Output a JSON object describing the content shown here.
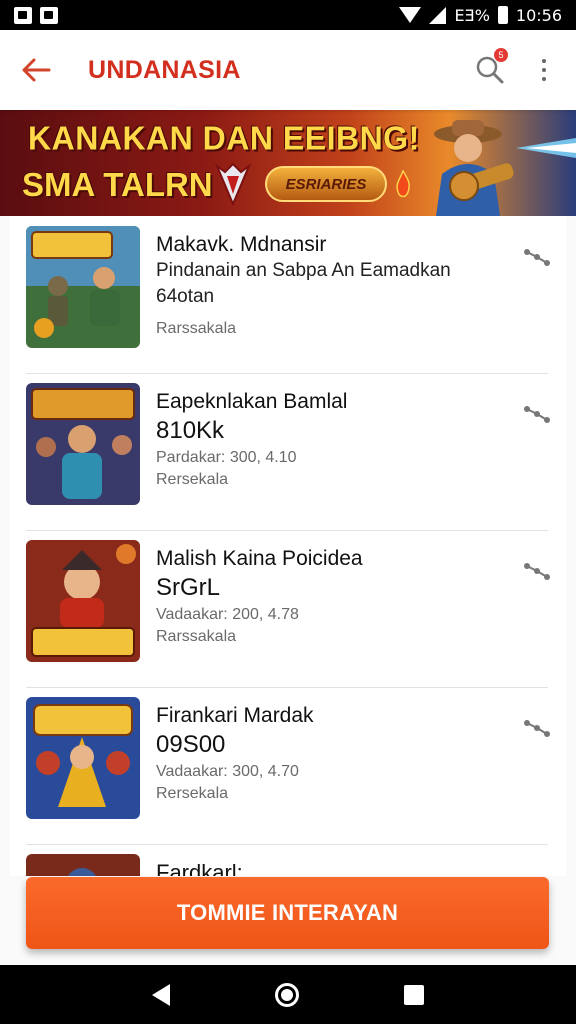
{
  "status_bar": {
    "time": "10:56",
    "battery_text": "EƎ%"
  },
  "app_bar": {
    "title": "UNDANASIA",
    "notification_count": "5",
    "accent": "#d32f1f"
  },
  "banner": {
    "line1": "KANAKAN DAN EEIBNG!",
    "line2": "SMA TALRN",
    "tag": "ESRIARIES"
  },
  "items": [
    {
      "title": "Makavk. Mdnansir",
      "subtitle": "Pindanain an Sabpa An Eamadkan",
      "subtitle2": "64otan",
      "meta": "Rarssakala"
    },
    {
      "title": "Eapeknlakan Bamlal",
      "big": "810Kk",
      "meta": "Pardakar: 300, 4.10",
      "meta2": "Rersekala"
    },
    {
      "title": "Malish Kaina Poicidea",
      "big": "SrGrL",
      "meta": "Vadaakar: 200, 4.78",
      "meta2": "Rarssakala"
    },
    {
      "title": "Firankari Mardak",
      "big": "09S00",
      "meta": "Vadaakar: 300, 4.70",
      "meta2": "Rersekala"
    },
    {
      "title": "Fardkarl:"
    }
  ],
  "cta": {
    "label": "TOMMIE INTERAYAN",
    "color": "#f25a1c"
  },
  "icons": {
    "back": "arrow-left-icon",
    "search": "search-icon",
    "more": "more-vertical-icon",
    "share": "share-icon"
  }
}
